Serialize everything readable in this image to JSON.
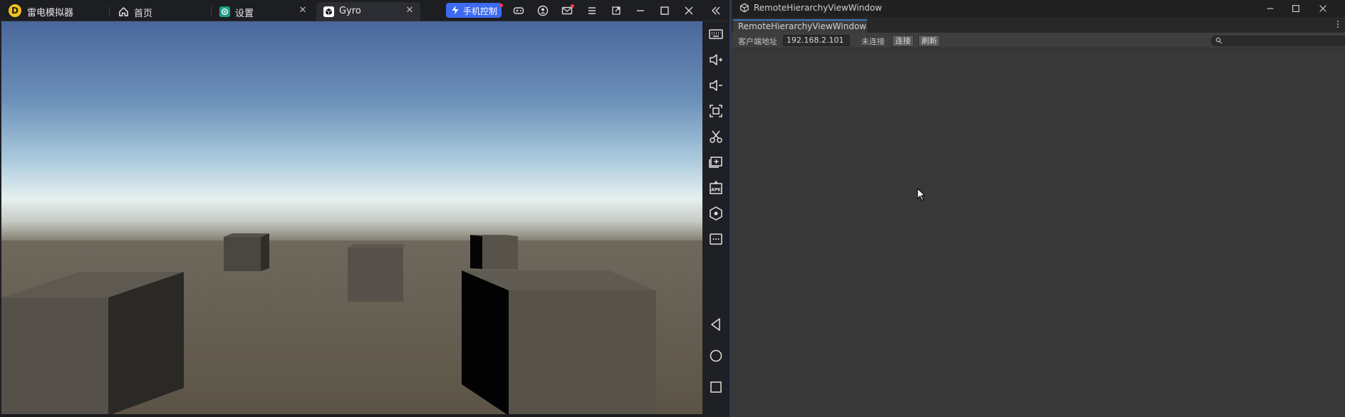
{
  "emulator": {
    "app_name": "雷电模拟器",
    "logo_glyph": "D",
    "tabs": [
      {
        "label": "首页",
        "icon": "home-icon"
      },
      {
        "label": "设置",
        "icon": "settings-app-icon"
      },
      {
        "label": "Gyro",
        "icon": "unity-app-icon",
        "active": true
      }
    ],
    "tab_close_glyph": "✕",
    "phone_control_label": "手机控制",
    "title_buttons": [
      "gamepad-icon",
      "user-icon",
      "mail-icon",
      "menu-icon",
      "restore-window-icon",
      "minimize-icon",
      "maximize-icon",
      "close-icon",
      "collapse-sidebar-icon"
    ],
    "sidebar_buttons": [
      "keyboard-icon",
      "volume-up-icon",
      "volume-down-icon",
      "screenshot-icon",
      "scissors-icon",
      "add-window-icon",
      "apk-install-icon",
      "operations-icon",
      "more-icon",
      "back-icon",
      "home-circle-icon",
      "recents-icon"
    ],
    "colors": {
      "accent": "#3d6af3",
      "logo": "#f4c21b"
    }
  },
  "unity": {
    "window_title": "RemoteHierarchyViewWindow",
    "tab_label": "RemoteHierarchyViewWindow",
    "address_label": "客户端地址",
    "address_value": "192.168.2.101",
    "status_text": "未连接",
    "connect_label": "连接",
    "refresh_label": "刷新",
    "colors": {
      "background": "#383838",
      "tab_highlight": "#3a79bb"
    }
  }
}
